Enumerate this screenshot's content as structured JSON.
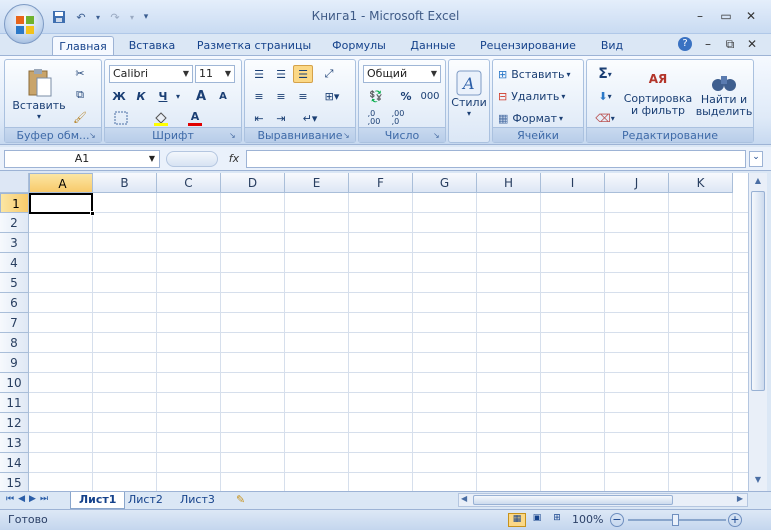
{
  "window": {
    "title": "Книга1 - Microsoft Excel"
  },
  "tabs": [
    "Главная",
    "Вставка",
    "Разметка страницы",
    "Формулы",
    "Данные",
    "Рецензирование",
    "Вид"
  ],
  "ribbon": {
    "clipboard": {
      "label": "Буфер обм...",
      "paste": "Вставить"
    },
    "font": {
      "label": "Шрифт",
      "name": "Calibri",
      "size": "11",
      "bold": "Ж",
      "italic": "К",
      "underline": "Ч",
      "grow": "A",
      "shrink": "A",
      "fontcolor": "A"
    },
    "alignment": {
      "label": "Выравнивание"
    },
    "number": {
      "label": "Число",
      "format": "Общий",
      "percent": "%",
      "thousands": "000",
      "inc": ",0\n,00",
      "dec": ",00\n,0"
    },
    "styles": {
      "label": "Стили"
    },
    "cells": {
      "label": "Ячейки",
      "insert": "Вставить",
      "delete": "Удалить",
      "format": "Формат"
    },
    "editing": {
      "label": "Редактирование",
      "sort": "Сортировка",
      "sort2": "и фильтр",
      "find": "Найти и",
      "find2": "выделить",
      "sigma": "Σ",
      "sortletters": "АЯ"
    }
  },
  "formula_bar": {
    "name_box": "A1",
    "fx": "fx",
    "content": ""
  },
  "grid": {
    "columns": [
      "A",
      "B",
      "C",
      "D",
      "E",
      "F",
      "G",
      "H",
      "I",
      "J",
      "K"
    ],
    "rows": [
      "1",
      "2",
      "3",
      "4",
      "5",
      "6",
      "7",
      "8",
      "9",
      "10",
      "11",
      "12",
      "13",
      "14",
      "15"
    ],
    "selected_cell": "A1"
  },
  "sheets": [
    "Лист1",
    "Лист2",
    "Лист3"
  ],
  "active_sheet": "Лист1",
  "status": {
    "text": "Готово",
    "zoom": "100%"
  }
}
